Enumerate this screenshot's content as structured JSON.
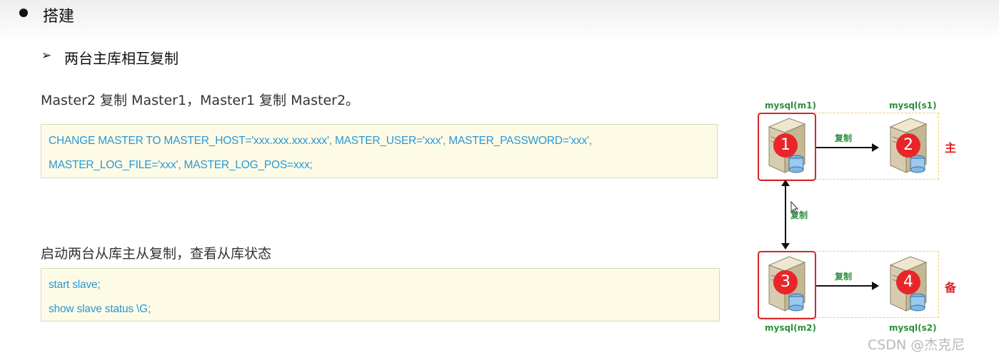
{
  "slide": {
    "heading": "搭建",
    "subheading_marker": "➢",
    "subheading": "两台主库相互复制",
    "para1": "Master2 复制 Master1，Master1 复制 Master2。",
    "code1": [
      "CHANGE MASTER TO MASTER_HOST='xxx.xxx.xxx.xxx', MASTER_USER='xxx', MASTER_PASSWORD='xxx',",
      "MASTER_LOG_FILE='xxx', MASTER_LOG_POS=xxx;"
    ],
    "para2": "启动两台从库主从复制，查看从库状态",
    "code2": [
      "start slave;",
      "show  slave  status \\G;"
    ]
  },
  "diagram": {
    "m1": "mysql(m1)",
    "s1": "mysql(s1)",
    "m2": "mysql(m2)",
    "s2": "mysql(s2)",
    "n1": "1",
    "n2": "2",
    "n3": "3",
    "n4": "4",
    "copy_top": "复制",
    "copy_mid": "复制",
    "copy_bottom": "复制",
    "role_primary": "主",
    "role_backup": "备"
  },
  "watermark": "CSDN @杰克尼",
  "colors": {
    "code_text": "#2c97d6",
    "code_bg": "#fdfbe6",
    "badge_red": "#e8262a",
    "label_green": "#2a8f3a"
  }
}
